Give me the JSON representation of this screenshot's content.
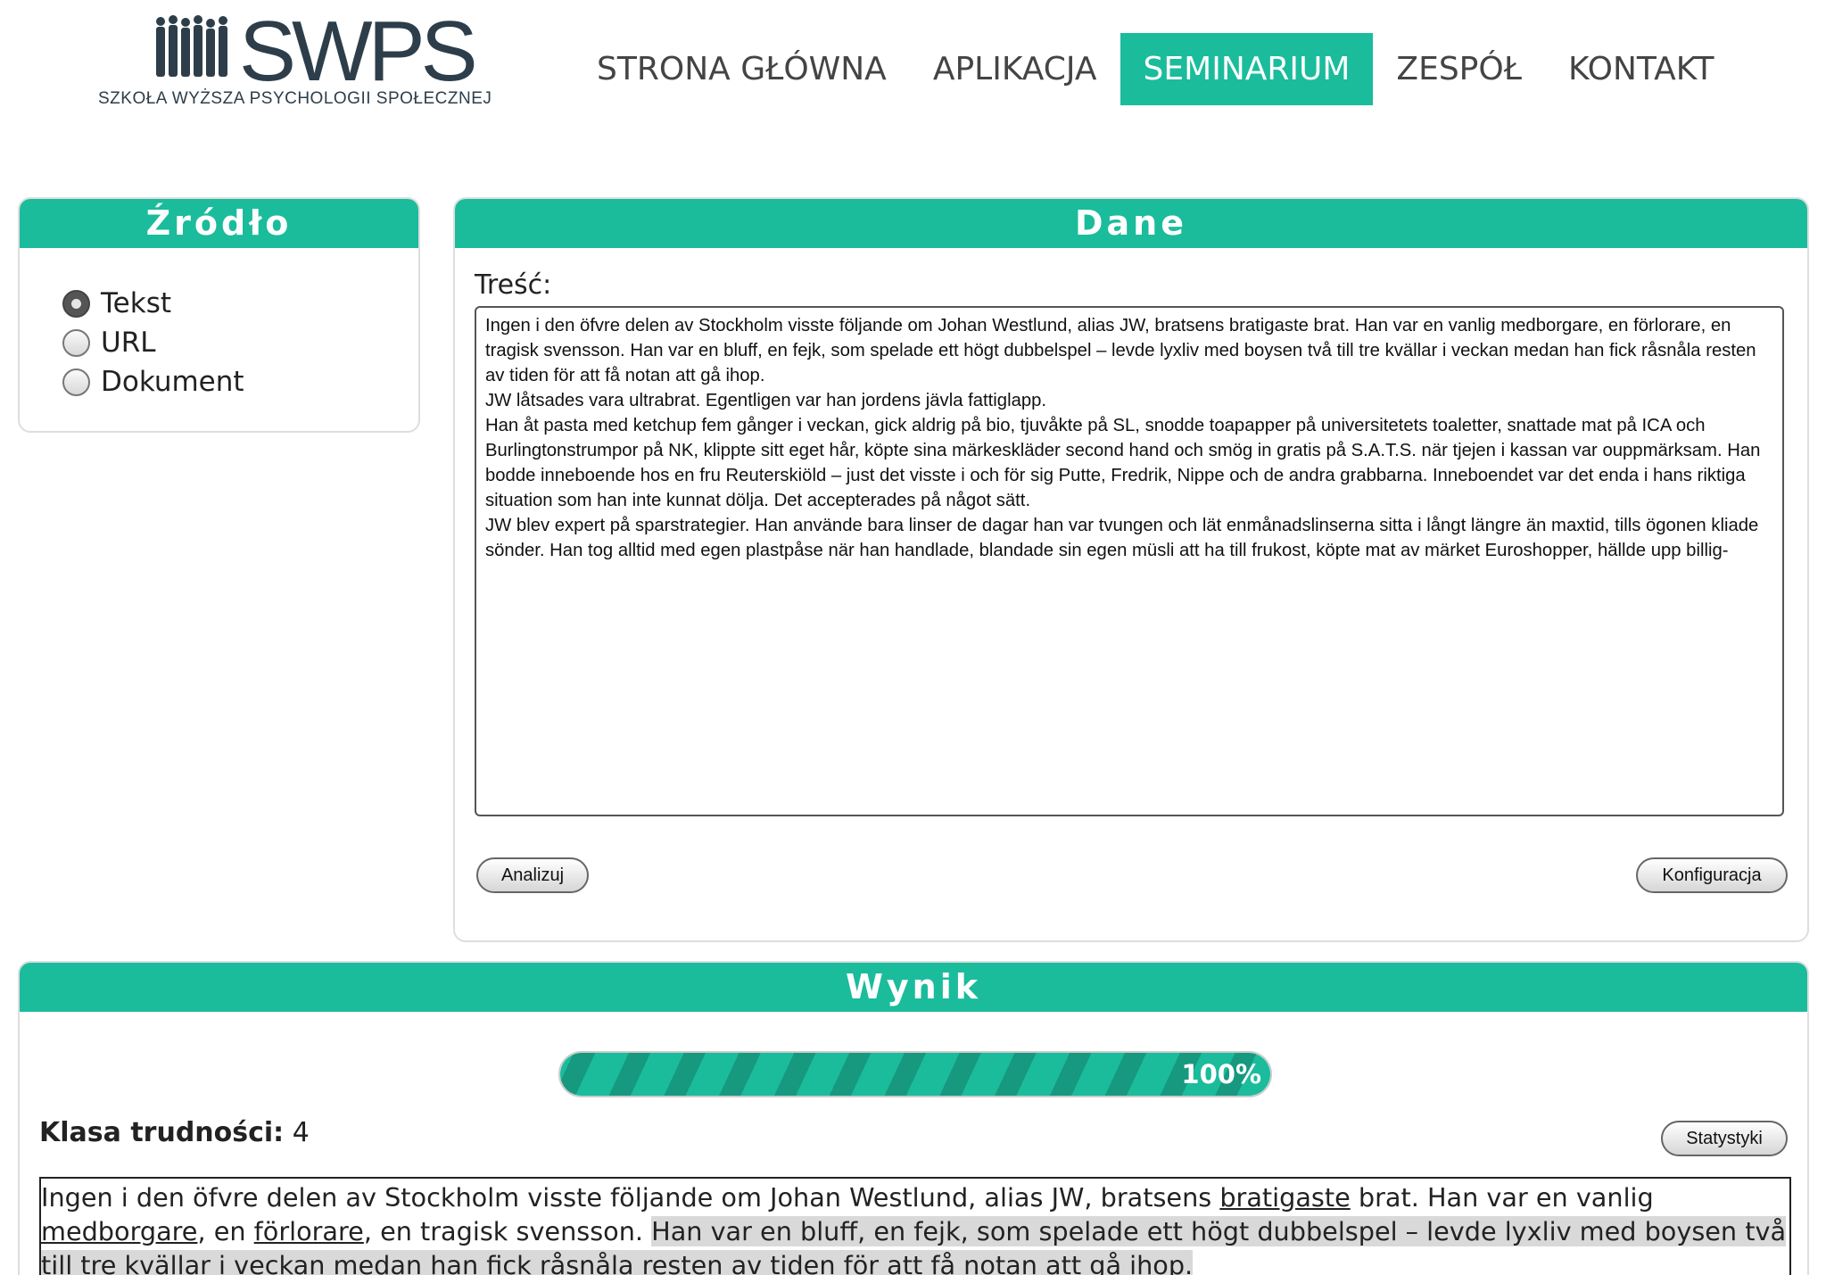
{
  "header": {
    "logo_word": "SWPS",
    "logo_sub": "SZKOŁA WYŻSZA PSYCHOLOGII SPOŁECZNEJ",
    "brand_color": "#2d3e4a",
    "nav": [
      {
        "label": "STRONA GŁÓWNA",
        "active": false
      },
      {
        "label": "APLIKACJA",
        "active": false
      },
      {
        "label": "SEMINARIUM",
        "active": true
      },
      {
        "label": "ZESPÓŁ",
        "active": false
      },
      {
        "label": "KONTAKT",
        "active": false
      }
    ]
  },
  "accent_color": "#1abc9c",
  "zrodlo": {
    "title": "Źródło",
    "options": [
      {
        "label": "Tekst",
        "checked": true
      },
      {
        "label": "URL",
        "checked": false
      },
      {
        "label": "Dokument",
        "checked": false
      }
    ]
  },
  "dane": {
    "title": "Dane",
    "content_label": "Treść:",
    "content_value": "Ingen i den öfvre delen av Stockholm visste följande om Johan Westlund, alias JW, bratsens bratigaste brat. Han var en vanlig medborgare, en förlorare, en tragisk svensson. Han var en bluff, en fejk, som spelade ett högt dubbelspel – levde lyxliv med boysen två till tre kvällar i veckan medan han fick råsnåla resten av tiden för att få notan att gå ihop.\nJW låtsades vara ultrabrat. Egentligen var han jordens jävla fattiglapp.\nHan åt pasta med ketchup fem gånger i veckan, gick aldrig på bio, tjuvåkte på SL, snodde toapapper på universitetets toaletter, snattade mat på ICA och Burlingtonstrumpor på NK, klippte sitt eget hår, köpte sina märkeskläder second hand och smög in gratis på S.A.T.S. när tjejen i kassan var ouppmärksam. Han bodde inneboende hos en fru Reuterskiöld – just det visste i och för sig Putte, Fredrik, Nippe och de andra grabbarna. Inneboendet var det enda i hans riktiga situation som han inte kunnat dölja. Det accepterades på något sätt.\nJW blev expert på sparstrategier. Han använde bara linser de dagar han var tvungen och lät enmånadslinserna sitta i långt längre än maxtid, tills ögonen kliade sönder. Han tog alltid med egen plastpåse när han handlade, blandade sin egen müsli att ha till frukost, köpte mat av märket Euroshopper, hällde upp billig-",
    "analyze_label": "Analizuj",
    "config_label": "Konfiguracja"
  },
  "wynik": {
    "title": "Wynik",
    "progress_percent": 100,
    "progress_text": "100%",
    "klasa_label": "Klasa trudności:",
    "klasa_value": "4",
    "stats_label": "Statystyki",
    "result_segments": [
      {
        "text": "Ingen i den öfvre delen av Stockholm visste följande om Johan Westlund, alias JW, bratsens ",
        "style": "plain"
      },
      {
        "text": "bratigaste",
        "style": "underline"
      },
      {
        "text": " brat. Han var en vanlig ",
        "style": "plain"
      },
      {
        "text": "medborgare",
        "style": "underline"
      },
      {
        "text": ", en ",
        "style": "plain"
      },
      {
        "text": "förlorare",
        "style": "underline"
      },
      {
        "text": ", en tragisk svensson. ",
        "style": "plain"
      },
      {
        "text": "Han var en bluff, en fejk, som spelade ett högt dubbelspel – levde lyxliv med boysen två till tre kvällar i veckan medan han fick råsnåla resten av tiden för att få notan att gå ihop.",
        "style": "highlight"
      }
    ]
  }
}
